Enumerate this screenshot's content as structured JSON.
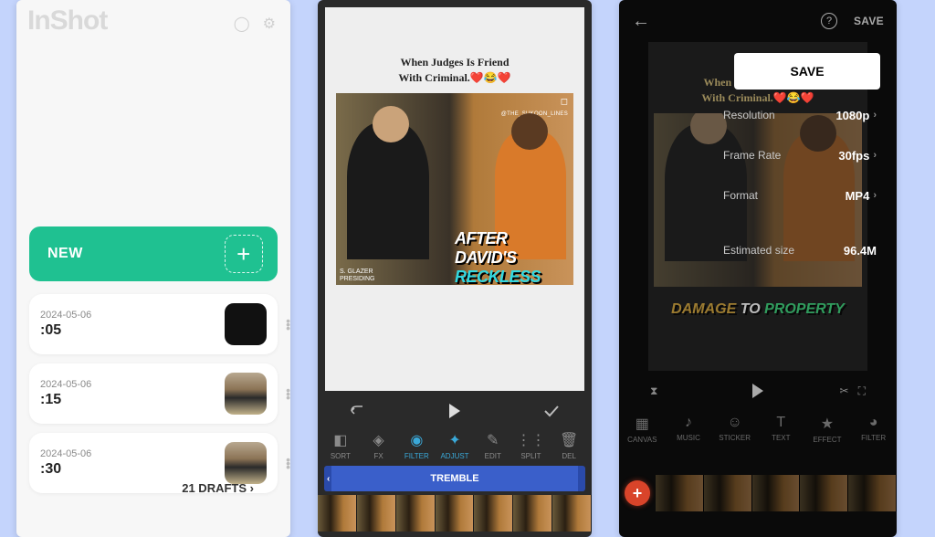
{
  "screen1": {
    "app_name": "InShot",
    "new_button": "NEW",
    "drafts": [
      {
        "date": "2024-05-06",
        "duration": ":05"
      },
      {
        "date": "2024-05-06",
        "duration": ":15"
      },
      {
        "date": "2024-05-06",
        "duration": ":30"
      }
    ],
    "drafts_footer": "21 DRAFTS",
    "footer_chevron": "›"
  },
  "screen2": {
    "caption_line1": "When Judges Is Friend",
    "caption_line2": "With Criminal.",
    "caption_emoji": "❤️😂❤️",
    "credit": "@THE_SUKOON_LINES",
    "nameplate_name": "S. GLAZER",
    "nameplate_role": "PRESIDING",
    "subtitle_part1": "AFTER DAVID'S ",
    "subtitle_part2": "RECKLESS",
    "track_label": "TREMBLE",
    "tools": [
      {
        "label": "SORT"
      },
      {
        "label": "FX"
      },
      {
        "label": "FILTER"
      },
      {
        "label": "ADJUST"
      },
      {
        "label": "EDIT"
      },
      {
        "label": "SPLIT"
      },
      {
        "label": "DEL"
      }
    ]
  },
  "screen3": {
    "save_header": "SAVE",
    "caption_line1": "When Judges Is Friend",
    "caption_line2": "With Criminal.",
    "caption_emoji": "❤️😂❤️",
    "subtitle_p1": "DAMAGE",
    "subtitle_p2": " TO ",
    "subtitle_p3": "PROPERTY",
    "panel": {
      "save_button": "SAVE",
      "resolution_label": "Resolution",
      "resolution_value": "1080p",
      "framerate_label": "Frame Rate",
      "framerate_value": "30fps",
      "format_label": "Format",
      "format_value": "MP4",
      "estimated_label": "Estimated size",
      "estimated_value": "96.4M"
    },
    "bottom_tools": [
      {
        "label": "CANVAS"
      },
      {
        "label": "MUSIC"
      },
      {
        "label": "STICKER"
      },
      {
        "label": "TEXT"
      },
      {
        "label": "EFFECT"
      },
      {
        "label": "FILTER"
      }
    ]
  }
}
